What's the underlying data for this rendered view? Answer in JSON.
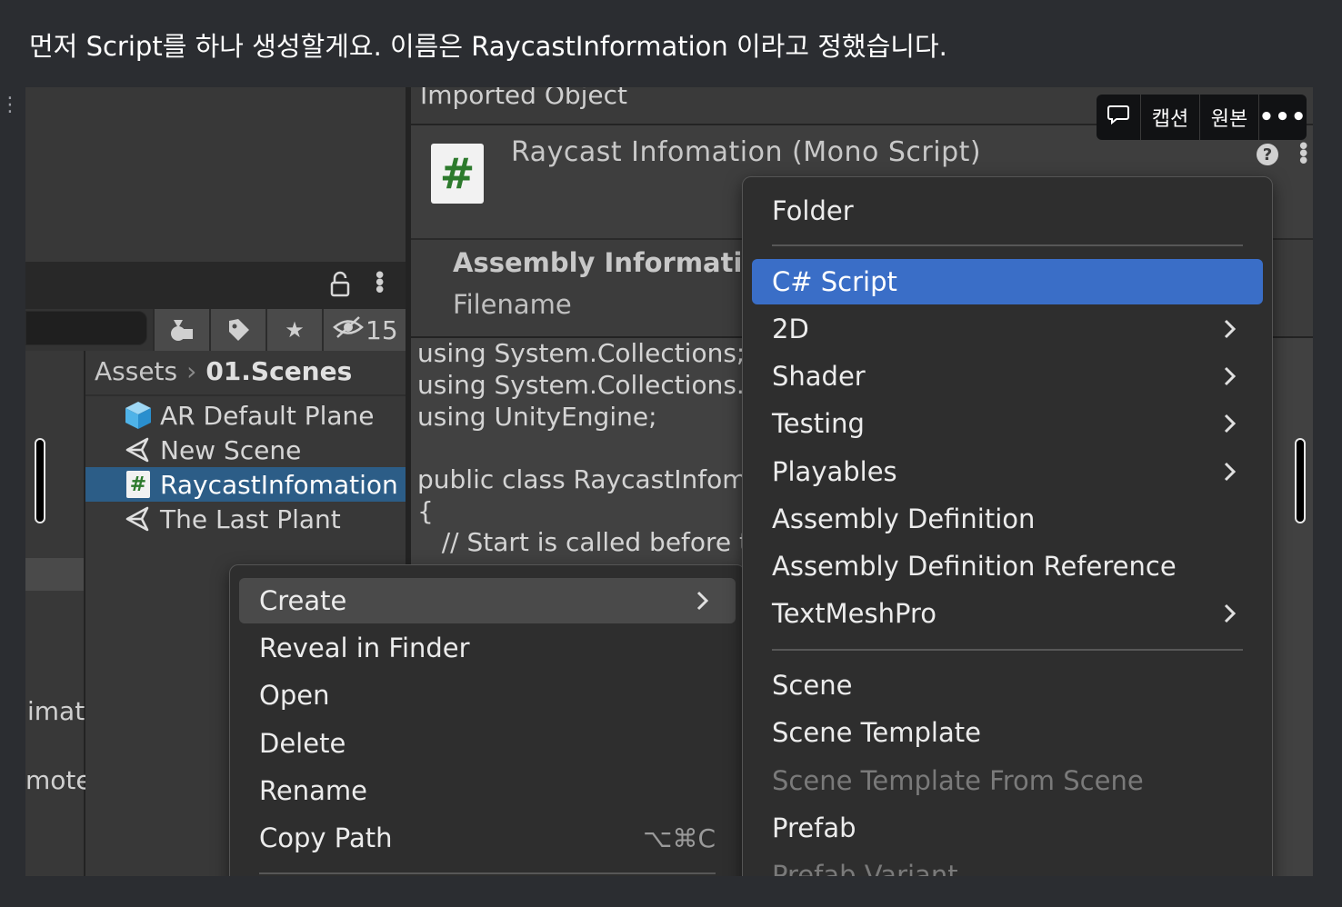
{
  "caption": "먼저 Script를 하나 생성할게요. 이름은 RaycastInformation 이라고 정했습니다.",
  "image_toolbar": {
    "comment_icon": "speech-bubble-icon",
    "caption_label": "캡션",
    "original_label": "원본",
    "more_icon": "more-horizontal-icon"
  },
  "project": {
    "breadcrumb": {
      "root": "Assets",
      "folder": "01.Scenes"
    },
    "filter_count": "15",
    "assets": [
      {
        "label": "AR Default Plane",
        "icon": "cube-prefab-icon"
      },
      {
        "label": "New Scene",
        "icon": "unity-scene-icon"
      },
      {
        "label": "RaycastInfomation",
        "icon": "csharp-script-icon",
        "selected": true
      },
      {
        "label": "The Last Plant",
        "icon": "unity-scene-icon"
      }
    ],
    "left_fragments": [
      "imat",
      "mote"
    ]
  },
  "inspector": {
    "header": "Imported Object",
    "title": "Raycast Infomation (Mono Script)",
    "assembly_title": "Assembly Information",
    "filename_label": "Filename",
    "code_lines": [
      "using System.Collections;",
      "using System.Collections.G",
      "using UnityEngine;",
      "",
      "public class RaycastInfoma",
      "{",
      "   // Start is called before th"
    ]
  },
  "context_menu": {
    "items": [
      {
        "label": "Create",
        "submenu": true,
        "hover": true
      },
      {
        "label": "Reveal in Finder"
      },
      {
        "label": "Open"
      },
      {
        "label": "Delete"
      },
      {
        "label": "Rename"
      },
      {
        "label": "Copy Path",
        "shortcut": "⌥⌘C"
      }
    ]
  },
  "create_menu": {
    "folder": "Folder",
    "items": [
      {
        "label": "C# Script",
        "active": true
      },
      {
        "label": "2D",
        "submenu": true
      },
      {
        "label": "Shader",
        "submenu": true
      },
      {
        "label": "Testing",
        "submenu": true
      },
      {
        "label": "Playables",
        "submenu": true
      },
      {
        "label": "Assembly Definition"
      },
      {
        "label": "Assembly Definition Reference"
      },
      {
        "label": "TextMeshPro",
        "submenu": true
      }
    ],
    "items2": [
      {
        "label": "Scene"
      },
      {
        "label": "Scene Template"
      },
      {
        "label": "Scene Template From Scene",
        "disabled": true
      },
      {
        "label": "Prefab"
      },
      {
        "label": "Prefab Variant",
        "disabled": true
      }
    ]
  }
}
